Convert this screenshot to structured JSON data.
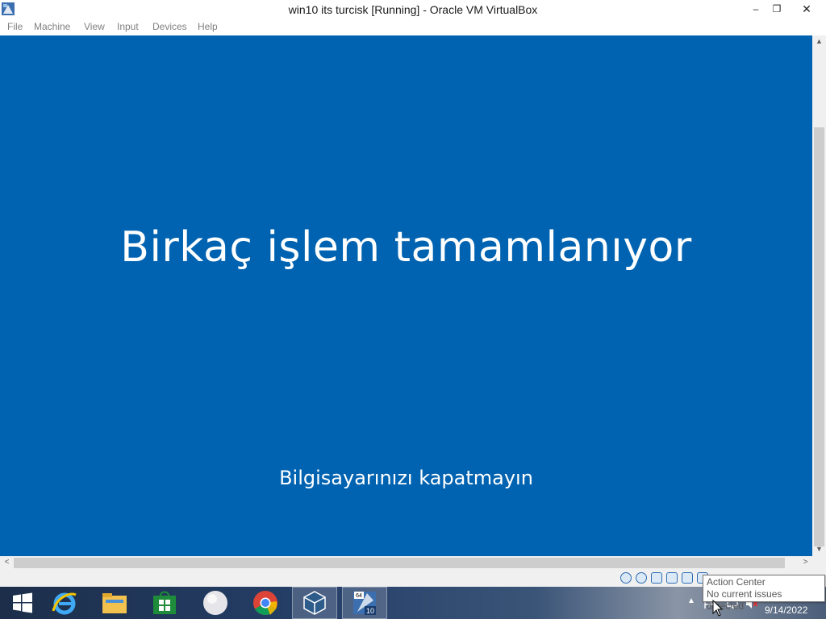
{
  "window": {
    "title": "win10 its turcisk [Running] - Oracle VM VirtualBox",
    "controls": {
      "minimize": "–",
      "maximize": "❐",
      "close": "✕"
    }
  },
  "menubar": {
    "items": [
      "File",
      "Machine",
      "View",
      "Input",
      "Devices",
      "Help"
    ]
  },
  "vm_screen": {
    "heading": "Birkaç işlem tamamlanıyor",
    "subtext": "Bilgisayarınızı kapatmayın",
    "background": "#0063b1"
  },
  "taskbar": {
    "apps": [
      "start-icon",
      "internet-explorer-icon",
      "file-explorer-icon",
      "store-icon",
      "blank-circle-icon",
      "chrome-icon",
      "virtualbox-icon",
      "virtualbox-win10-vm-icon"
    ],
    "vm_badge_top": "64",
    "vm_badge_bottom": "10",
    "tray_arrow": "▲",
    "date": "9/14/2022"
  },
  "tooltip": {
    "title": "Action Center",
    "body": "No current issues detected"
  }
}
